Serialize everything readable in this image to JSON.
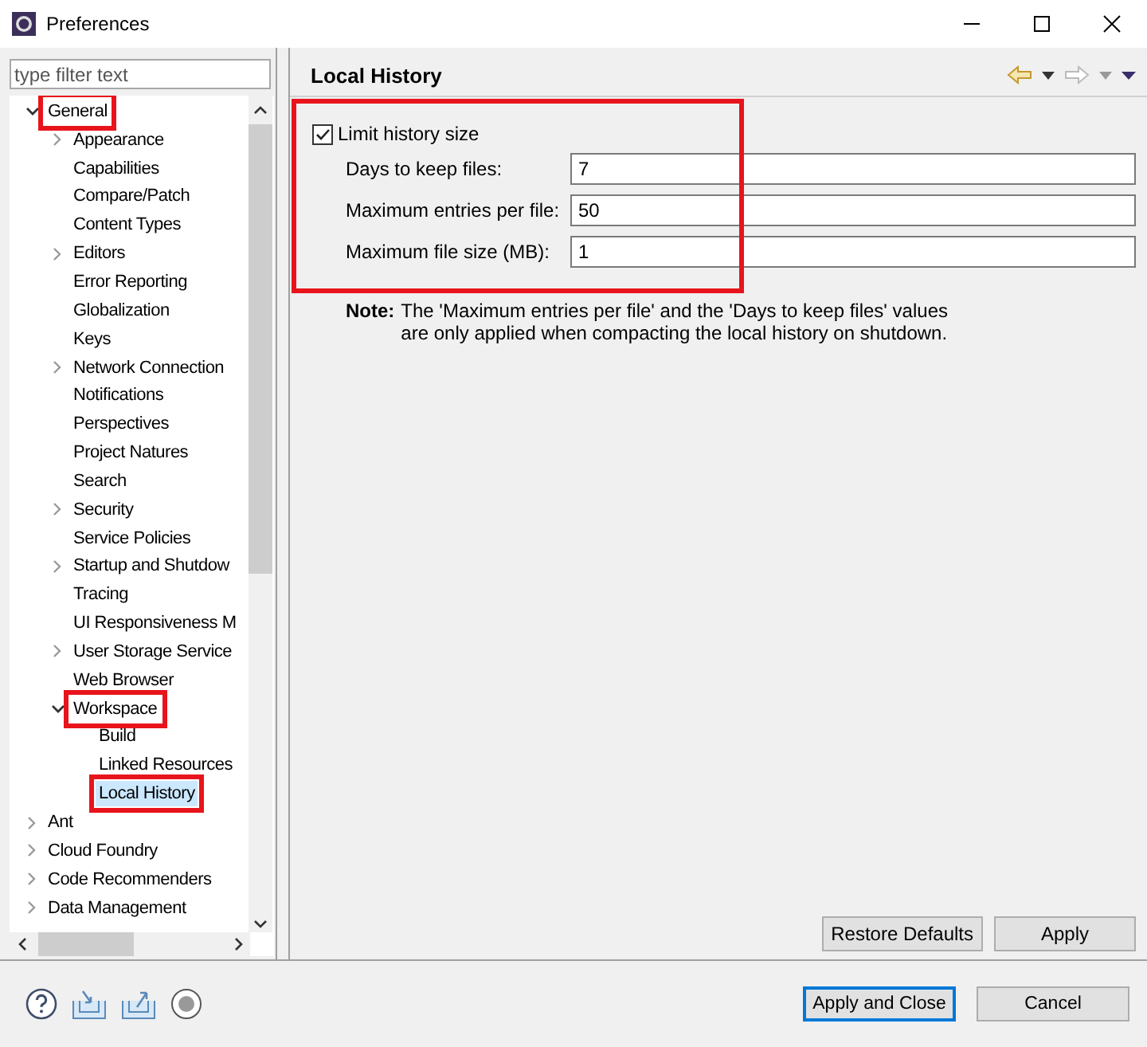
{
  "window": {
    "title": "Preferences"
  },
  "filter": {
    "placeholder": "type filter text"
  },
  "tree": [
    {
      "label": "General",
      "expanded": true,
      "selected": false,
      "annotated": true,
      "children": [
        {
          "label": "Appearance",
          "expanded": false,
          "selected": false,
          "annotated": false
        },
        {
          "label": "Capabilities",
          "selected": false,
          "annotated": false
        },
        {
          "label": "Compare/Patch",
          "selected": false,
          "annotated": false
        },
        {
          "label": "Content Types",
          "selected": false,
          "annotated": false
        },
        {
          "label": "Editors",
          "expanded": false,
          "selected": false,
          "annotated": false
        },
        {
          "label": "Error Reporting",
          "selected": false,
          "annotated": false
        },
        {
          "label": "Globalization",
          "selected": false,
          "annotated": false
        },
        {
          "label": "Keys",
          "selected": false,
          "annotated": false
        },
        {
          "label": "Network Connection",
          "expanded": false,
          "selected": false,
          "annotated": false
        },
        {
          "label": "Notifications",
          "selected": false,
          "annotated": false
        },
        {
          "label": "Perspectives",
          "selected": false,
          "annotated": false
        },
        {
          "label": "Project Natures",
          "selected": false,
          "annotated": false
        },
        {
          "label": "Search",
          "selected": false,
          "annotated": false
        },
        {
          "label": "Security",
          "expanded": false,
          "selected": false,
          "annotated": false
        },
        {
          "label": "Service Policies",
          "selected": false,
          "annotated": false
        },
        {
          "label": "Startup and Shutdow",
          "expanded": false,
          "selected": false,
          "annotated": false
        },
        {
          "label": "Tracing",
          "selected": false,
          "annotated": false
        },
        {
          "label": "UI Responsiveness M",
          "selected": false,
          "annotated": false
        },
        {
          "label": "User Storage Service",
          "expanded": false,
          "selected": false,
          "annotated": false
        },
        {
          "label": "Web Browser",
          "selected": false,
          "annotated": false
        },
        {
          "label": "Workspace",
          "expanded": true,
          "selected": false,
          "annotated": true,
          "children": [
            {
              "label": "Build",
              "selected": false,
              "annotated": false
            },
            {
              "label": "Linked Resources",
              "selected": false,
              "annotated": false
            },
            {
              "label": "Local History",
              "selected": true,
              "annotated": true
            }
          ]
        }
      ]
    },
    {
      "label": "Ant",
      "expanded": false,
      "selected": false,
      "annotated": false
    },
    {
      "label": "Cloud Foundry",
      "expanded": false,
      "selected": false,
      "annotated": false
    },
    {
      "label": "Code Recommenders",
      "expanded": false,
      "selected": false,
      "annotated": false
    },
    {
      "label": "Data Management",
      "expanded": false,
      "selected": false,
      "annotated": false
    }
  ],
  "page": {
    "title": "Local History",
    "limit": {
      "label": "Limit history size",
      "checked": true,
      "annotated": true
    },
    "fields": [
      {
        "label": "Days to keep files:",
        "value": "7"
      },
      {
        "label": "Maximum entries per file:",
        "value": "50"
      },
      {
        "label": "Maximum file size (MB):",
        "value": "1"
      }
    ],
    "note": {
      "label": "Note:",
      "lines": [
        "The 'Maximum entries per file' and the 'Days to keep files' values",
        "are only applied when compacting the local history on shutdown."
      ]
    },
    "buttons": [
      "Restore Defaults",
      "Apply"
    ]
  },
  "footer": {
    "buttons": [
      {
        "label": "Apply and Close",
        "default": true
      },
      {
        "label": "Cancel",
        "default": false
      }
    ]
  }
}
